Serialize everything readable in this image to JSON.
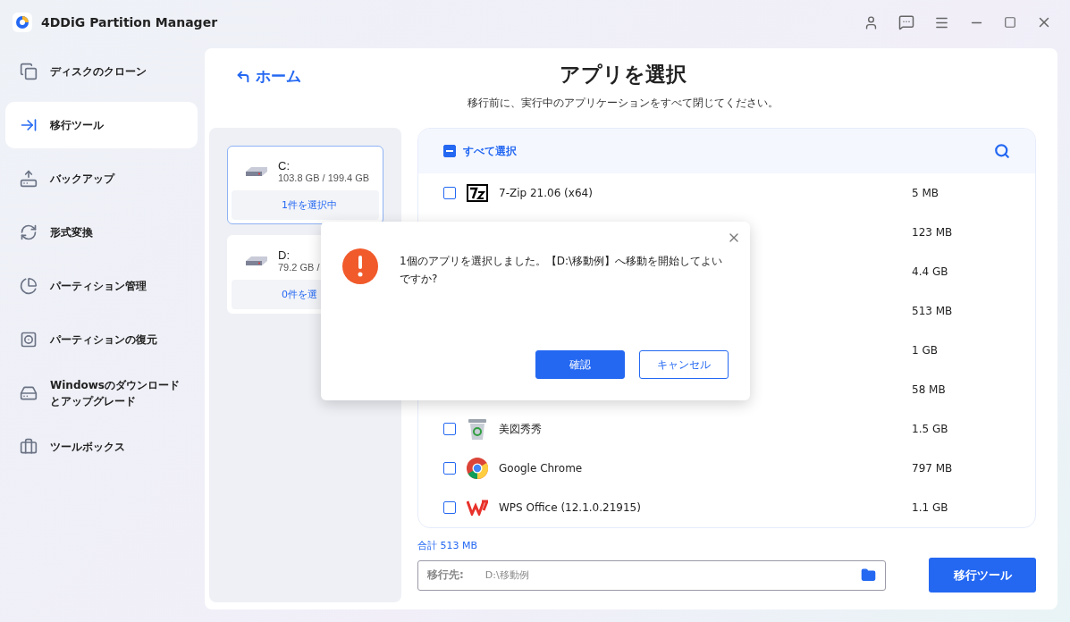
{
  "app": {
    "title": "4DDiG Partition Manager"
  },
  "sidebar": {
    "items": [
      {
        "label": "ディスクのクローン",
        "selected": false
      },
      {
        "label": "移行ツール",
        "selected": true
      },
      {
        "label": "バックアップ",
        "selected": false
      },
      {
        "label": "形式変換",
        "selected": false
      },
      {
        "label": "パーティション管理",
        "selected": false
      },
      {
        "label": "パーティションの復元",
        "selected": false
      },
      {
        "label": "Windowsのダウンロードとアップグレード",
        "selected": false
      },
      {
        "label": "ツールボックス",
        "selected": false
      }
    ]
  },
  "header": {
    "back": "ホーム",
    "title": "アプリを選択",
    "subtitle": "移行前に、実行中のアプリケーションをすべて閉じてください。"
  },
  "drives": [
    {
      "name": "C:",
      "usage": "103.8 GB / 199.4 GB",
      "count": "1件を選択中",
      "selected": true
    },
    {
      "name": "D:",
      "usage": "79.2 GB /",
      "count": "0件を選",
      "selected": false
    }
  ],
  "app_list": {
    "select_all": "すべて選択",
    "select_all_checked": true,
    "rows": [
      {
        "name": "7-Zip 21.06 (x64)",
        "size": "5 MB",
        "checked": false
      },
      {
        "size": "123 MB"
      },
      {
        "size": "4.4 GB"
      },
      {
        "size": "513 MB"
      },
      {
        "size": "1 GB"
      },
      {
        "size": "58 MB"
      },
      {
        "name": "美図秀秀",
        "size": "1.5 GB",
        "checked": false
      },
      {
        "name": "Google Chrome",
        "size": "797 MB",
        "checked": false
      },
      {
        "name": "WPS Office (12.1.0.21915)",
        "size": "1.1 GB",
        "checked": false
      }
    ]
  },
  "total": "合計 513 MB",
  "destination": {
    "label": "移行先:",
    "value": "D:\\移動例"
  },
  "migrate_button": "移行ツール",
  "dialog": {
    "message": "1個のアプリを選択しました。【D:\\移動例】へ移動を開始してよいですか?",
    "confirm": "確認",
    "cancel": "キャンセル"
  }
}
